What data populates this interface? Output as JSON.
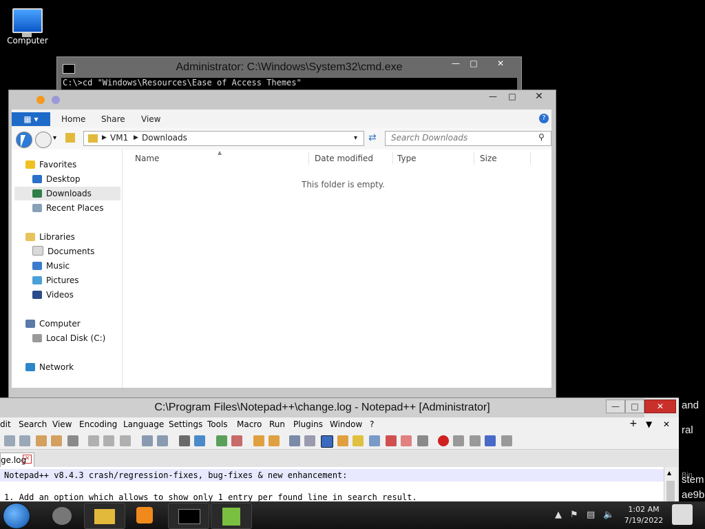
{
  "desktop": {
    "computer_label": "Computer",
    "side_words": [
      "and",
      "ral",
      "stem",
      "ae9b",
      "Bin"
    ]
  },
  "cmd": {
    "title": "Administrator: C:\\Windows\\System32\\cmd.exe",
    "line": "C:\\>cd \"Windows\\Resources\\Ease of Access Themes\""
  },
  "explorer": {
    "ribbon": {
      "home": "Home",
      "share": "Share",
      "view": "View"
    },
    "address": {
      "root": "VM1",
      "folder": "Downloads"
    },
    "search_placeholder": "Search Downloads",
    "nav": {
      "favorites": "Favorites",
      "desktop": "Desktop",
      "downloads": "Downloads",
      "recent": "Recent Places",
      "libraries": "Libraries",
      "documents": "Documents",
      "music": "Music",
      "pictures": "Pictures",
      "videos": "Videos",
      "computer": "Computer",
      "localdisk": "Local Disk (C:)",
      "network": "Network"
    },
    "columns": {
      "name": "Name",
      "date": "Date modified",
      "type": "Type",
      "size": "Size"
    },
    "empty_text": "This folder is empty."
  },
  "npp": {
    "title": "C:\\Program Files\\Notepad++\\change.log - Notepad++ [Administrator]",
    "menu": [
      "dit",
      "Search",
      "View",
      "Encoding",
      "Language",
      "Settings",
      "Tools",
      "Macro",
      "Run",
      "Plugins",
      "Window",
      "?"
    ],
    "tab": "ge.log",
    "line1": "Notepad++ v8.4.3 crash/regression-fixes, bug-fixes & new enhancement:",
    "line2": "1.  Add an option which allows to show only 1 entry per found line in search result."
  },
  "taskbar": {
    "time": "1:02 AM",
    "date": "7/19/2022"
  }
}
